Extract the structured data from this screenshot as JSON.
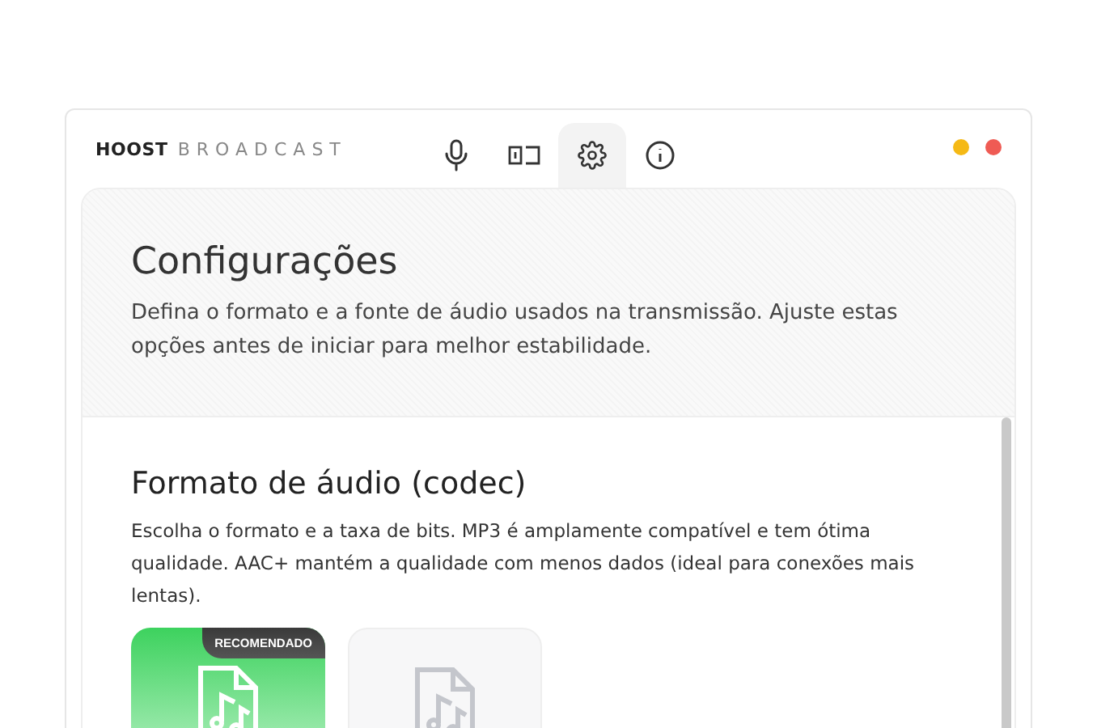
{
  "brand": {
    "bold": "HOOST",
    "light": "BROADCAST"
  },
  "tabs": [
    {
      "kind": "mic",
      "selected": false
    },
    {
      "kind": "display",
      "selected": false
    },
    {
      "kind": "settings",
      "selected": true
    },
    {
      "kind": "info",
      "selected": false
    }
  ],
  "header": {
    "title": "Configurações",
    "description": "Defina o formato e a fonte de áudio usados na transmissão. Ajuste estas opções antes de iniciar para melhor estabilidade."
  },
  "section": {
    "title": "Formato de áudio (codec)",
    "description": "Escolha o formato e a taxa de bits. MP3 é amplamente compatível e tem ótima qualidade. AAC+ mantém a qualidade com menos dados (ideal para conexões mais lentas)."
  },
  "formats": [
    {
      "selected": true,
      "badge": "RECOMENDADO"
    },
    {
      "selected": false
    }
  ]
}
